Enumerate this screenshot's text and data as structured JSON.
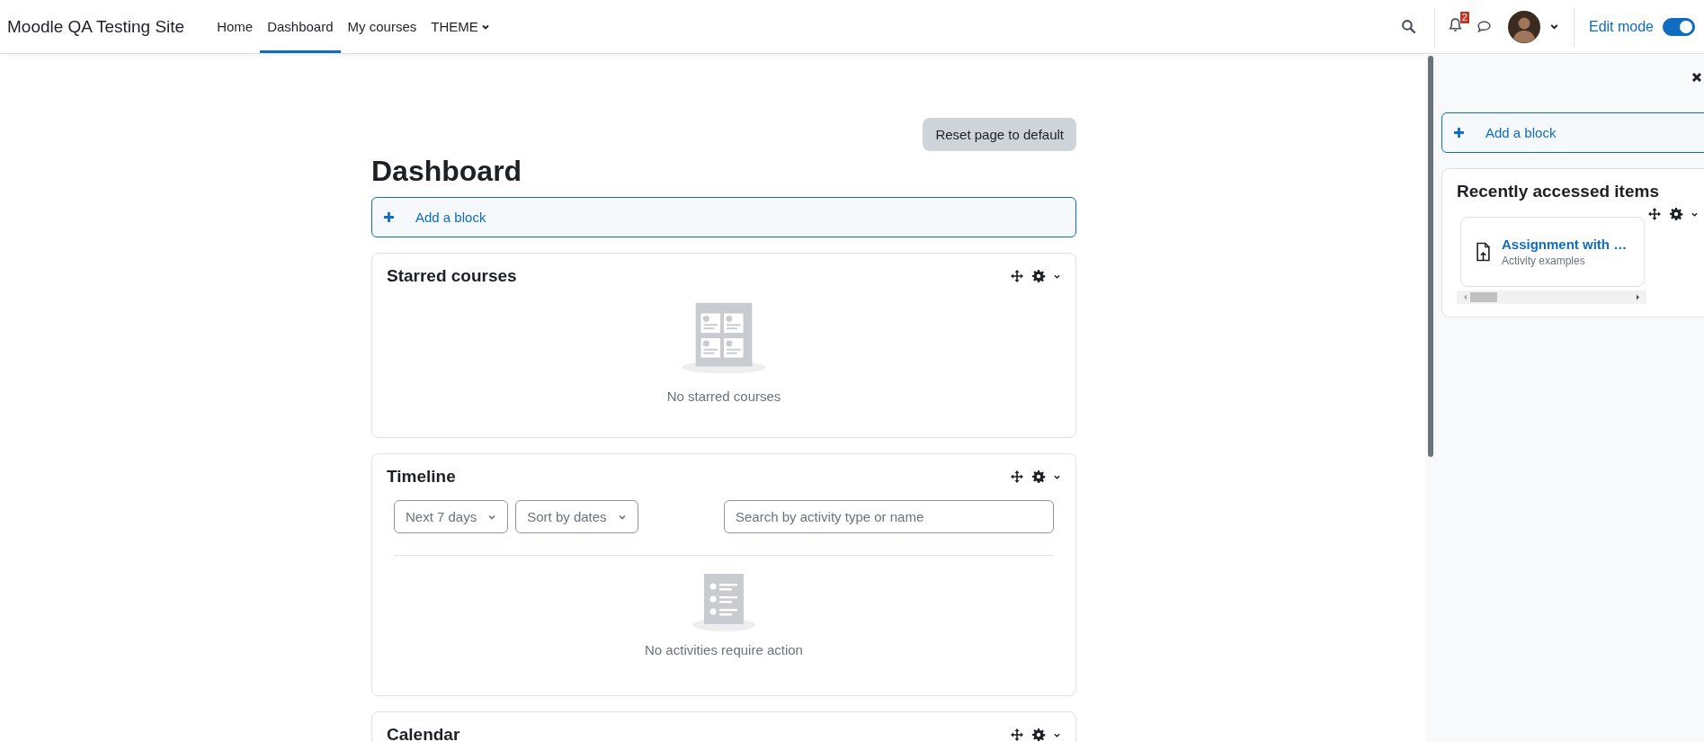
{
  "navbar": {
    "site_name": "Moodle QA Testing Site",
    "nav_items": [
      {
        "label": "Home",
        "selected": false,
        "kind": "link"
      },
      {
        "label": "Dashboard",
        "selected": true,
        "kind": "link"
      },
      {
        "label": "My courses",
        "selected": false,
        "kind": "link"
      },
      {
        "label": "THEME",
        "selected": false,
        "kind": "dropdown"
      }
    ],
    "notification_count": "2",
    "edit_mode": {
      "label": "Edit mode",
      "on": true
    }
  },
  "main": {
    "reset_button": "Reset page to default",
    "title": "Dashboard",
    "add_block": "Add a block",
    "blocks": [
      {
        "title": "Starred courses",
        "kind": "starred",
        "message": "No starred courses"
      },
      {
        "title": "Timeline",
        "kind": "timeline",
        "filters": [
          "Next 7 days",
          "Sort by dates"
        ],
        "search_placeholder": "Search by activity type or name",
        "message": "No activities require action"
      },
      {
        "title": "Calendar",
        "kind": "calendar"
      }
    ]
  },
  "drawer": {
    "add_block": "Add a block",
    "recent": {
      "title": "Recently accessed items",
      "items": [
        {
          "name": "Assignment with …",
          "course": "Activity examples"
        }
      ]
    }
  }
}
